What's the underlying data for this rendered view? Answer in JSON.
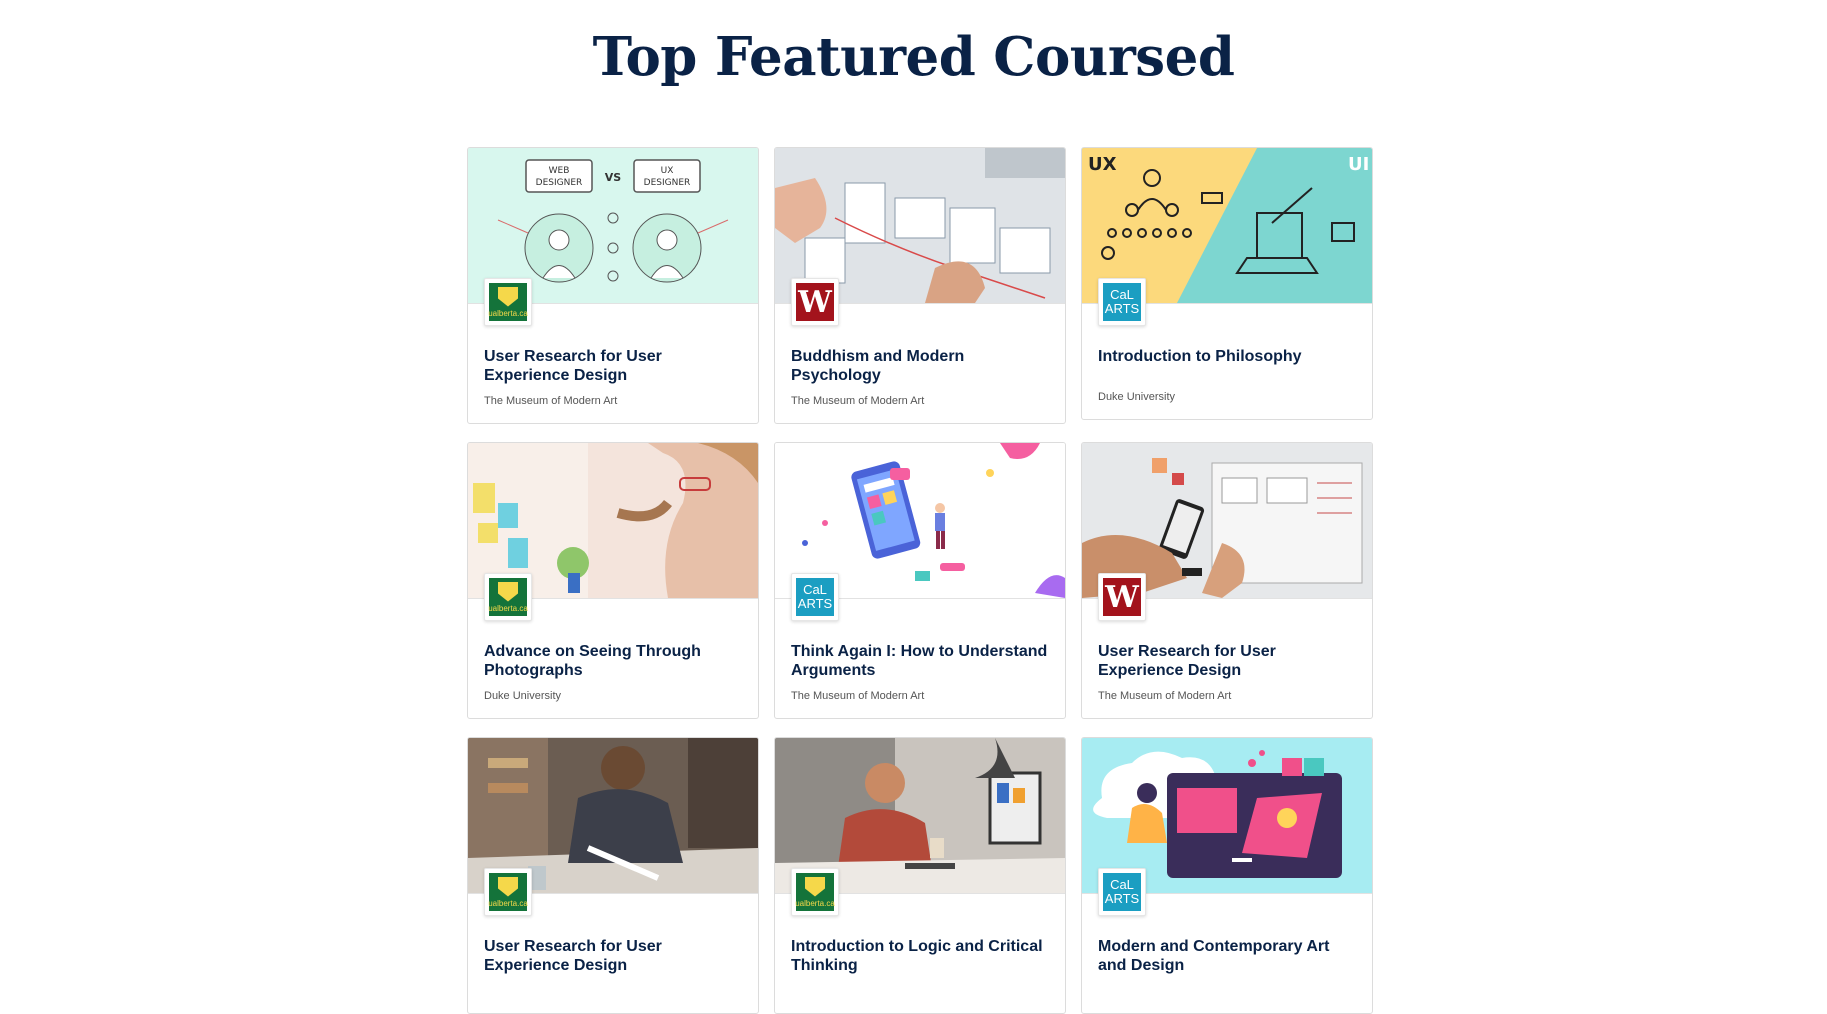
{
  "page": {
    "title": "Top Featured Coursed"
  },
  "colors": {
    "title": "#0a2246",
    "ualberta": "#14733a",
    "wesleyan": "#a3131c",
    "calarts": "#1b9ec2"
  },
  "courses": [
    {
      "title": "User Research for User Experience Design",
      "org": "The Museum of Modern Art",
      "logo": "ualberta-logo",
      "logo_text": "ualberta.ca",
      "image": "web-vs-ux-designer-illustration"
    },
    {
      "title": "Buddhism and Modern Psychology",
      "org": "The Museum of Modern Art",
      "logo": "wesleyan-logo",
      "logo_text": "W",
      "image": "wireframe-sketching-photo"
    },
    {
      "title": "Introduction to Philosophy",
      "org": "Duke University",
      "logo": "calarts-logo",
      "logo_text": "CaL ARTS",
      "image": "ux-ui-illustration"
    },
    {
      "title": "Advance on Seeing Through Photographs",
      "org": "Duke University",
      "logo": "ualberta-logo",
      "logo_text": "ualberta.ca",
      "image": "woman-at-whiteboard-photo"
    },
    {
      "title": "Think Again I: How to Understand Arguments",
      "org": "The Museum of Modern Art",
      "logo": "calarts-logo",
      "logo_text": "CaL ARTS",
      "image": "mobile-app-isometric-illustration"
    },
    {
      "title": "User Research for User Experience Design",
      "org": "The Museum of Modern Art",
      "logo": "wesleyan-logo",
      "logo_text": "W",
      "image": "phone-prototype-photo"
    },
    {
      "title": "User Research for User Experience Design",
      "org": "",
      "logo": "ualberta-logo",
      "logo_text": "ualberta.ca",
      "image": "man-drawing-photo"
    },
    {
      "title": "Introduction to Logic and Critical Thinking",
      "org": "",
      "logo": "ualberta-logo",
      "logo_text": "ualberta.ca",
      "image": "man-at-computer-photo"
    },
    {
      "title": "Modern and Contemporary Art and Design",
      "org": "",
      "logo": "calarts-logo",
      "logo_text": "CaL ARTS",
      "image": "web-design-illustration"
    }
  ]
}
